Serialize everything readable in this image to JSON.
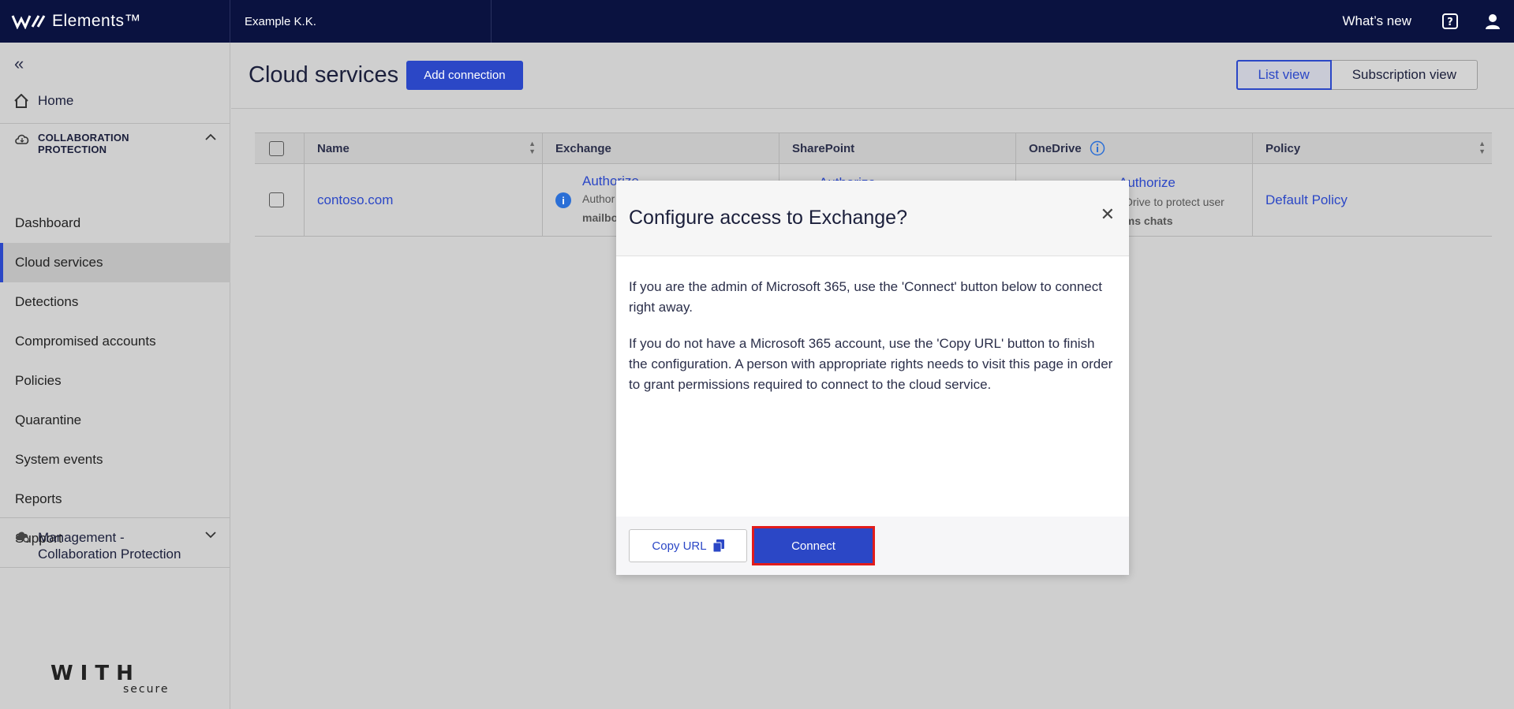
{
  "topbar": {
    "brand": "Elements™",
    "org": "Example K.K.",
    "whats_new": "What’s new"
  },
  "sidebar": {
    "home": "Home",
    "group_label_1": "COLLABORATION",
    "group_label_2": "PROTECTION",
    "items": [
      {
        "label": "Dashboard"
      },
      {
        "label": "Cloud services"
      },
      {
        "label": "Detections"
      },
      {
        "label": "Compromised accounts"
      },
      {
        "label": "Policies"
      },
      {
        "label": "Quarantine"
      },
      {
        "label": "System events"
      },
      {
        "label": "Reports"
      },
      {
        "label": "Support"
      }
    ],
    "mgmt_label_1": "Management -",
    "mgmt_label_2": "Collaboration Protection",
    "logo_text_top": "WITH",
    "logo_text_bottom": "secure"
  },
  "main": {
    "title": "Cloud services",
    "add_connection": "Add connection",
    "list_view": "List view",
    "subscription_view": "Subscription view"
  },
  "table": {
    "headers": {
      "name": "Name",
      "exchange": "Exchange",
      "sharepoint": "SharePoint",
      "onedrive": "OneDrive",
      "policy": "Policy"
    },
    "row": {
      "name": "contoso.com",
      "exchange_auth": "Authorize",
      "exchange_sub1": "Author",
      "exchange_sub2": "mailbo",
      "onedrive_auth": "Authorize",
      "onedrive_sub1": "eDrive to protect user",
      "onedrive_sub2": "ams chats",
      "sharepoint_auth": "Authorize",
      "policy": "Default Policy"
    }
  },
  "modal": {
    "title": "Configure access to Exchange?",
    "para1": "If you are the admin of Microsoft 365, use the 'Connect' button below to connect right away.",
    "para2": "If you do not have a Microsoft 365 account, use the 'Copy URL' button to finish the configuration. A person with appropriate rights needs to visit this page in order to grant permissions required to connect to the cloud service.",
    "copy_url": "Copy URL",
    "connect": "Connect"
  },
  "colors": {
    "topbar": "#0a1240",
    "accent": "#2b47c6",
    "highlight": "#e11c1c"
  }
}
